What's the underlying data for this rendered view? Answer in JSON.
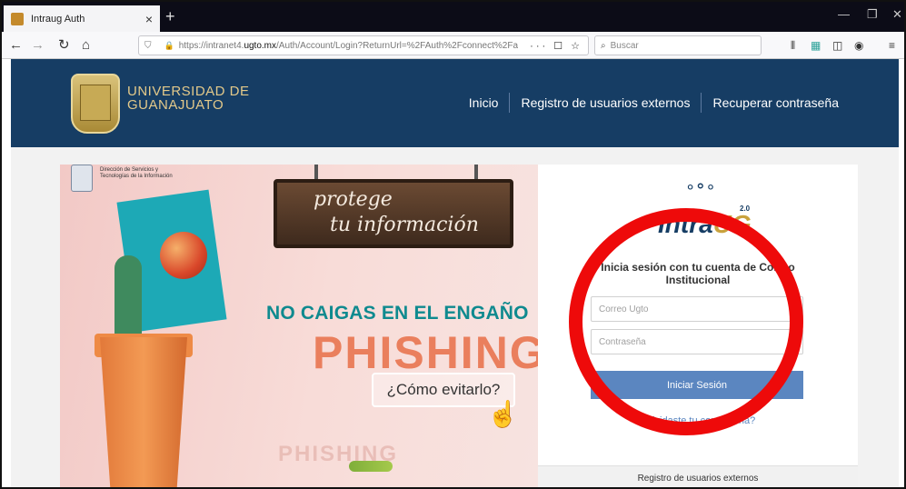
{
  "browser": {
    "tab_title": "Intraug Auth",
    "tab_close": "×",
    "new_tab": "+",
    "url_prefix": "https://intranet4.",
    "url_host": "ugto.mx",
    "url_rest": "/Auth/Account/Login?ReturnUrl=%2FAuth%2Fconnect%2Fa",
    "url_actions": "··· ☐ ☆",
    "search_placeholder": "Buscar"
  },
  "site": {
    "brand_line1": "UNIVERSIDAD DE",
    "brand_line2": "GUANAJUATO",
    "nav": [
      "Inicio",
      "Registro de usuarios externos",
      "Recuperar contraseña"
    ]
  },
  "banner": {
    "dsti_line1": "Dirección de Servicios y",
    "dsti_line2": "Tecnologías de la Información",
    "sign_line1": "protege",
    "sign_line2": "tu información",
    "headline": "NO CAIGAS EN EL ENGAÑO",
    "big_word": "PHISHING",
    "button": "¿Cómo evitarlo?",
    "ghost": "PHISHING"
  },
  "login": {
    "logo_text_a": "Intra",
    "logo_text_b": "UG",
    "logo_version": "2.0",
    "prompt": "Inicia sesión con tu cuenta de Correo Institucional",
    "email_placeholder": "Correo Ugto",
    "password_placeholder": "Contraseña",
    "submit": "Iniciar Sesión",
    "forgot": "¿Olvidaste tu contraseña?",
    "footer": "Registro de usuarios externos"
  },
  "colors": {
    "header_bg": "#163d64",
    "button_blue": "#5b86c0",
    "annotation_red": "#ee0a0a"
  }
}
